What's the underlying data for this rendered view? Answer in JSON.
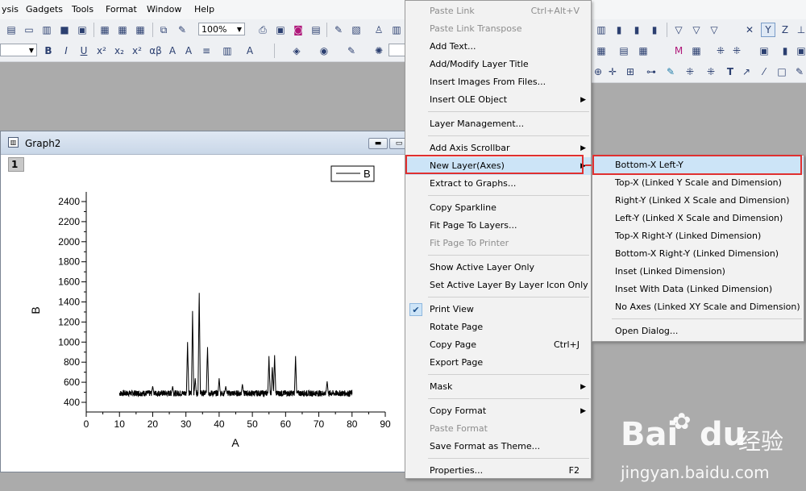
{
  "menubar": {
    "items": [
      "ysis",
      "Gadgets",
      "Tools",
      "Format",
      "Window",
      "Help"
    ]
  },
  "toolbar": {
    "zoom": "100%"
  },
  "graph_window": {
    "title": "Graph2",
    "layer_number": "1",
    "legend": "B"
  },
  "chart_data": {
    "type": "line",
    "xlabel": "A",
    "ylabel": "B",
    "xlim": [
      0,
      90
    ],
    "ylim": [
      300,
      2500
    ],
    "x_ticks": [
      0,
      10,
      20,
      30,
      40,
      50,
      60,
      70,
      80,
      90
    ],
    "y_ticks": [
      400,
      600,
      800,
      1000,
      1200,
      1400,
      1600,
      1800,
      2000,
      2200,
      2400
    ],
    "series": [
      {
        "name": "B",
        "color": "#000000",
        "x_range": [
          10,
          80
        ],
        "baseline": 490,
        "noise": 30,
        "peaks": [
          {
            "x": 20,
            "y": 560
          },
          {
            "x": 26,
            "y": 560
          },
          {
            "x": 30.5,
            "y": 1000
          },
          {
            "x": 32,
            "y": 1310
          },
          {
            "x": 32.8,
            "y": 640
          },
          {
            "x": 34,
            "y": 1490
          },
          {
            "x": 36.5,
            "y": 950
          },
          {
            "x": 40,
            "y": 640
          },
          {
            "x": 42,
            "y": 560
          },
          {
            "x": 47,
            "y": 580
          },
          {
            "x": 55,
            "y": 860
          },
          {
            "x": 56,
            "y": 750
          },
          {
            "x": 56.7,
            "y": 870
          },
          {
            "x": 63,
            "y": 860
          },
          {
            "x": 72.5,
            "y": 610
          }
        ]
      }
    ]
  },
  "context_menu": {
    "items": [
      {
        "label": "Paste Link",
        "shortcut": "Ctrl+Alt+V",
        "disabled": true
      },
      {
        "label": "Paste Link Transpose",
        "disabled": true
      },
      {
        "label": "Add Text..."
      },
      {
        "label": "Add/Modify Layer Title"
      },
      {
        "label": "Insert Images From Files..."
      },
      {
        "label": "Insert OLE Object",
        "submenu": true
      },
      {
        "separator": true
      },
      {
        "label": "Layer Management..."
      },
      {
        "separator": true
      },
      {
        "label": "Add Axis Scrollbar",
        "submenu": true
      },
      {
        "label": "New Layer(Axes)",
        "submenu": true,
        "highlighted": true
      },
      {
        "label": "Extract to Graphs..."
      },
      {
        "separator": true
      },
      {
        "label": "Copy Sparkline"
      },
      {
        "label": "Fit Page To Layers..."
      },
      {
        "label": "Fit Page To Printer",
        "disabled": true
      },
      {
        "separator": true
      },
      {
        "label": "Show Active Layer Only"
      },
      {
        "label": "Set Active Layer By Layer Icon Only"
      },
      {
        "separator": true
      },
      {
        "label": "Print View",
        "checked": true
      },
      {
        "label": "Rotate Page"
      },
      {
        "label": "Copy Page",
        "shortcut": "Ctrl+J"
      },
      {
        "label": "Export Page"
      },
      {
        "separator": true
      },
      {
        "label": "Mask",
        "submenu": true
      },
      {
        "separator": true
      },
      {
        "label": "Copy Format",
        "submenu": true
      },
      {
        "label": "Paste Format",
        "disabled": true
      },
      {
        "label": "Save Format as Theme..."
      },
      {
        "separator": true
      },
      {
        "label": "Properties...",
        "shortcut": "F2"
      }
    ]
  },
  "submenu": {
    "items": [
      {
        "label": "Bottom-X Left-Y",
        "highlighted": true
      },
      {
        "label": "Top-X (Linked Y Scale and Dimension)"
      },
      {
        "label": "Right-Y (Linked X Scale and Dimension)"
      },
      {
        "label": "Left-Y (Linked X Scale and Dimension)"
      },
      {
        "label": "Top-X Right-Y (Linked Dimension)"
      },
      {
        "label": "Bottom-X Right-Y (Linked Dimension)"
      },
      {
        "label": "Inset (Linked Dimension)"
      },
      {
        "label": "Inset With Data (Linked Dimension)"
      },
      {
        "label": "No Axes (Linked XY Scale and Dimension)"
      },
      {
        "separator": true
      },
      {
        "label": "Open Dialog..."
      }
    ]
  },
  "watermark": {
    "brand_latin_1": "Bai",
    "brand_latin_2": "du",
    "brand_cn": "经验",
    "url": "jingyan.baidu.com"
  },
  "colors": {
    "highlight": "#cce4f7",
    "highlight_border": "#e03030",
    "check_bg": "#cde4f7"
  }
}
